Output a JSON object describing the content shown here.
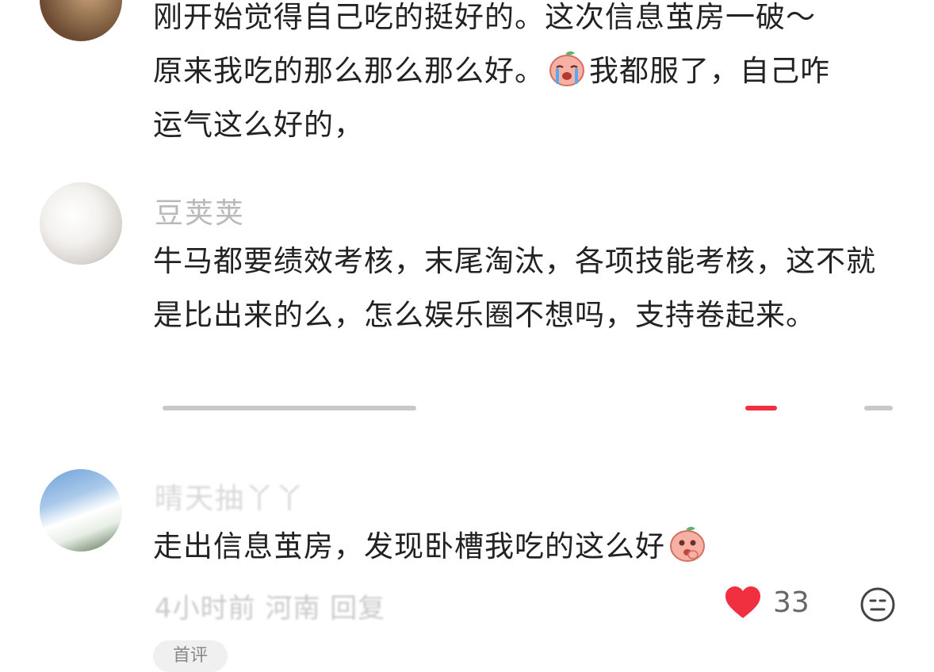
{
  "comments": [
    {
      "text_line1": "刚开始觉得自己吃的挺好的。这次信息茧房一破～",
      "text_line2_before": "原来我吃的那么那么那么好。",
      "emoji": "crying-peach-emoji",
      "text_line2_after": "我都服了，自己咋",
      "text_line3": "运气这么好的，"
    },
    {
      "username": "豆荚荚",
      "text": "牛马都要绩效考核，末尾淘汰，各项技能考核，这不就是比出来的么，怎么娱乐圈不想吗，支持卷起来。"
    },
    {
      "username": "晴天抽丫丫",
      "text": "走出信息茧房，发现卧槽我吃的这么好",
      "emoji": "shy-peach-emoji",
      "meta": "4小时前 河南 回复",
      "likes": "33",
      "tag": "首评"
    }
  ],
  "colors": {
    "like": "#f0303f",
    "text": "#222222",
    "muted": "#b9b9b9"
  }
}
